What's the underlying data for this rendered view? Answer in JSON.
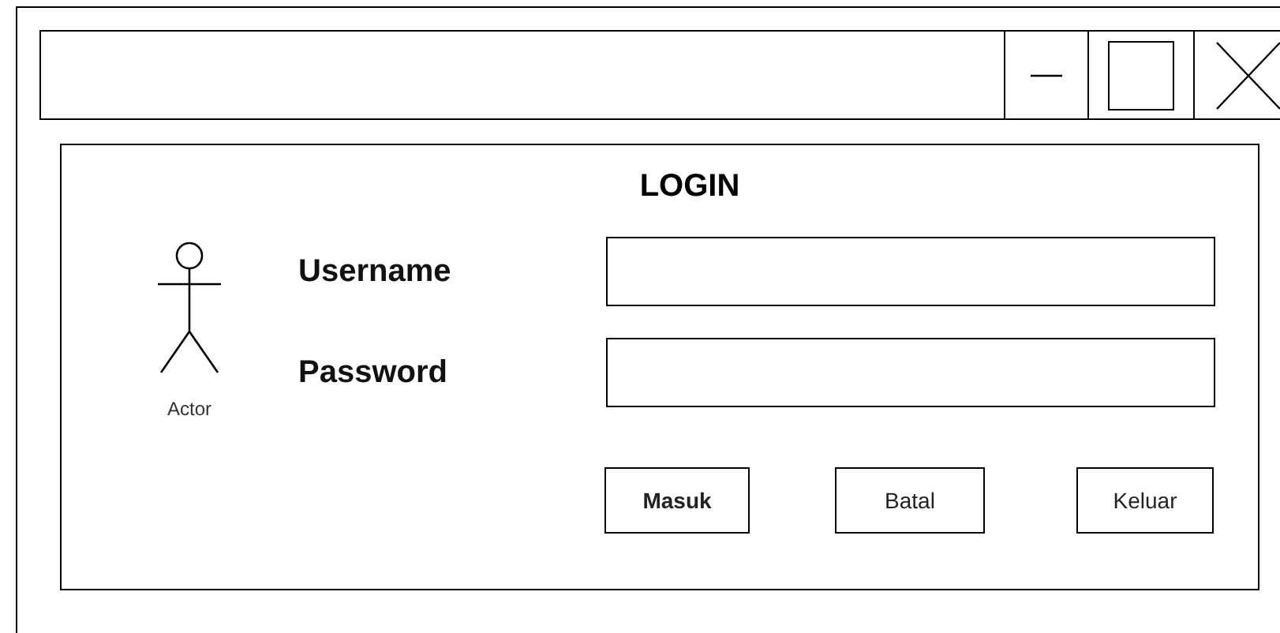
{
  "window": {
    "controls": [
      {
        "kind": "minimize"
      },
      {
        "kind": "maximize"
      },
      {
        "kind": "close"
      }
    ]
  },
  "form": {
    "title": "LOGIN",
    "actor_label": "Actor",
    "fields": [
      {
        "label": "Username"
      },
      {
        "label": "Password"
      }
    ],
    "buttons": [
      "Masuk",
      "Batal",
      "Keluar"
    ]
  }
}
